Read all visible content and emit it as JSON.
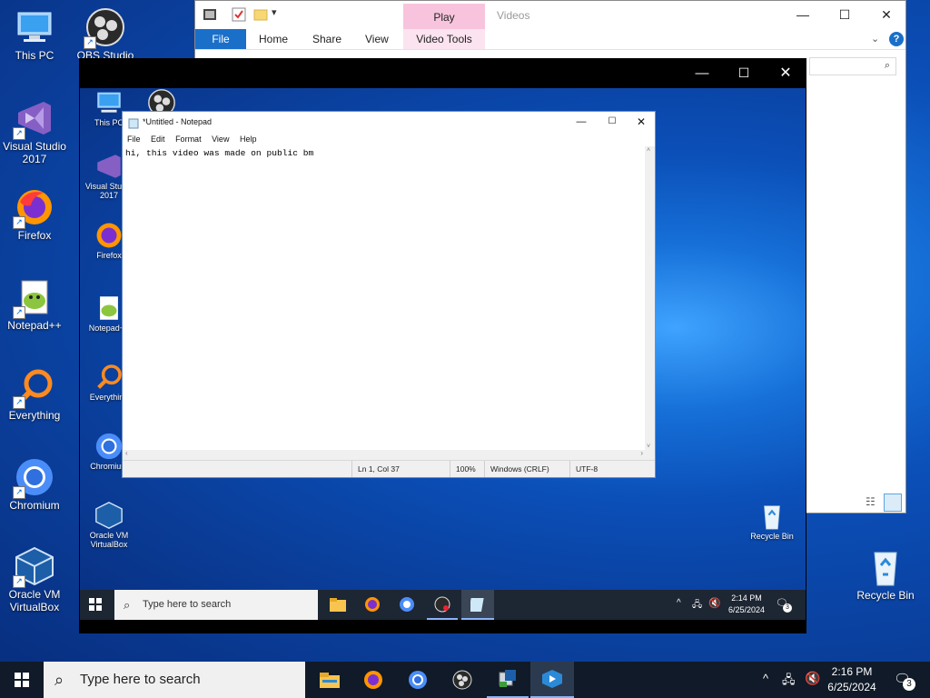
{
  "desktop": {
    "icons": [
      {
        "label": "This PC"
      },
      {
        "label": "OBS Studio"
      },
      {
        "label": "Visual Studio 2017"
      },
      {
        "label": "Firefox"
      },
      {
        "label": "Notepad++"
      },
      {
        "label": "Everything"
      },
      {
        "label": "Chromium"
      },
      {
        "label": "Oracle VM VirtualBox"
      },
      {
        "label": "Recycle Bin"
      }
    ]
  },
  "explorer": {
    "contextual_tab": "Play",
    "title": "Videos",
    "tabs": [
      "File",
      "Home",
      "Share",
      "View",
      "Video Tools"
    ]
  },
  "vm": {
    "icons": [
      {
        "label": "This PC"
      },
      {
        "label": "Visual Studio 2017"
      },
      {
        "label": "Firefox"
      },
      {
        "label": "Notepad++"
      },
      {
        "label": "Everything"
      },
      {
        "label": "Chromium"
      },
      {
        "label": "Oracle VM VirtualBox"
      },
      {
        "label": "Recycle Bin"
      }
    ],
    "notepad": {
      "title": "*Untitled - Notepad",
      "menu": [
        "File",
        "Edit",
        "Format",
        "View",
        "Help"
      ],
      "text": "hi, this video was made on public bm",
      "status": {
        "position": "Ln 1, Col 37",
        "zoom": "100%",
        "line_ending": "Windows (CRLF)",
        "encoding": "UTF-8"
      }
    },
    "taskbar": {
      "search_placeholder": "Type here to search",
      "time": "2:14 PM",
      "date": "6/25/2024",
      "notification_count": "3"
    }
  },
  "taskbar": {
    "search_placeholder": "Type here to search",
    "time": "2:16 PM",
    "date": "6/25/2024",
    "notification_count": "3"
  }
}
